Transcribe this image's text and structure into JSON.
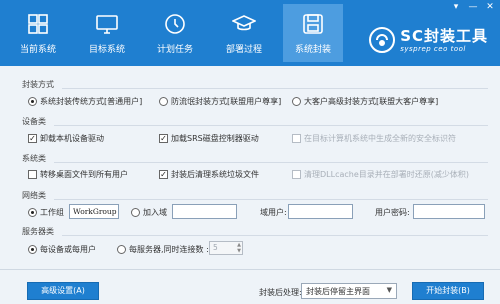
{
  "window": {
    "controls": {
      "menu": "▾",
      "minimize": "—",
      "close": "✕"
    }
  },
  "nav": {
    "tabs": [
      {
        "label": "当前系统",
        "icon": "windows-icon",
        "active": false
      },
      {
        "label": "目标系统",
        "icon": "monitor-icon",
        "active": false
      },
      {
        "label": "计划任务",
        "icon": "clock-icon",
        "active": false
      },
      {
        "label": "部署过程",
        "icon": "graduation-cap-icon",
        "active": false
      },
      {
        "label": "系统封装",
        "icon": "disk-icon",
        "active": true
      }
    ]
  },
  "brand": {
    "title": "SC封装工具",
    "subtitle": "sysprep ceo tool"
  },
  "sections": {
    "mode": {
      "title": "封装方式",
      "options": [
        {
          "label": "系统封装传统方式[普通用户]",
          "checked": true
        },
        {
          "label": "防流氓封装方式[联盟用户尊享]",
          "checked": false
        },
        {
          "label": "大客户高级封装方式[联盟大客户尊享]",
          "checked": false
        }
      ]
    },
    "device": {
      "title": "设备类",
      "options": [
        {
          "label": "卸载本机设备驱动",
          "checked": true,
          "disabled": false
        },
        {
          "label": "加载SRS磁盘控制器驱动",
          "checked": true,
          "disabled": false
        },
        {
          "label": "在目标计算机系统中生成全新的安全标识符",
          "checked": false,
          "disabled": true
        }
      ]
    },
    "system": {
      "title": "系统类",
      "options": [
        {
          "label": "转移桌面文件到所有用户",
          "checked": false,
          "disabled": false
        },
        {
          "label": "封装后清理系统垃圾文件",
          "checked": true,
          "disabled": false
        },
        {
          "label": "清理DLLcache目录并在部署时还原(减少体积)",
          "checked": false,
          "disabled": true
        }
      ]
    },
    "network": {
      "title": "网络类",
      "workgroup_label": "工作组",
      "workgroup_value": "WorkGroup",
      "domain_label": "加入域",
      "domain_user_label": "域用户:",
      "user_password_label": "用户密码:"
    },
    "server": {
      "title": "服务器类",
      "per_device_label": "每设备或每用户",
      "per_server_label": "每服务器,同时连接数 :",
      "connections": "5"
    }
  },
  "footer": {
    "advanced_button": "高级设置(A)",
    "after_label": "封装后处理:",
    "after_select": "封装后停留主界面",
    "start_button": "开始封装(B)"
  }
}
